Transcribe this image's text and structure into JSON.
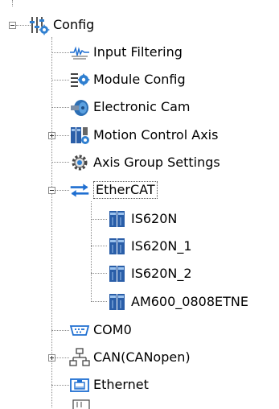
{
  "tree": {
    "root": {
      "label": "Config",
      "icon": "config-sliders-gear-icon",
      "expanded": true
    },
    "items": [
      {
        "label": "Input Filtering",
        "icon": "input-filtering-icon"
      },
      {
        "label": "Module Config",
        "icon": "module-config-icon"
      },
      {
        "label": "Electronic Cam",
        "icon": "electronic-cam-icon"
      },
      {
        "label": "Motion Control Axis",
        "icon": "motion-axis-icon",
        "expandable": true,
        "expanded": false
      },
      {
        "label": "Axis Group Settings",
        "icon": "axis-group-gear-icon"
      },
      {
        "label": "EtherCAT",
        "icon": "ethercat-arrows-icon",
        "expandable": true,
        "expanded": true,
        "selected": true,
        "children": [
          {
            "label": "IS620N",
            "icon": "servo-drive-icon"
          },
          {
            "label": "IS620N_1",
            "icon": "servo-drive-icon"
          },
          {
            "label": "IS620N_2",
            "icon": "servo-drive-icon"
          },
          {
            "label": "AM600_0808ETNE",
            "icon": "io-module-icon"
          }
        ]
      },
      {
        "label": "COM0",
        "icon": "serial-port-icon"
      },
      {
        "label": "CAN(CANopen)",
        "icon": "can-network-icon",
        "expandable": true,
        "expanded": false
      },
      {
        "label": "Ethernet",
        "icon": "ethernet-port-icon"
      }
    ]
  },
  "colors": {
    "tree_line": "#8c8c8c",
    "config_blue": "#2f7fd0",
    "drive_blue": "#2a5ea8",
    "ethercat_blue": "#1f6fd1",
    "cam_blue": "#2c6fb5"
  }
}
